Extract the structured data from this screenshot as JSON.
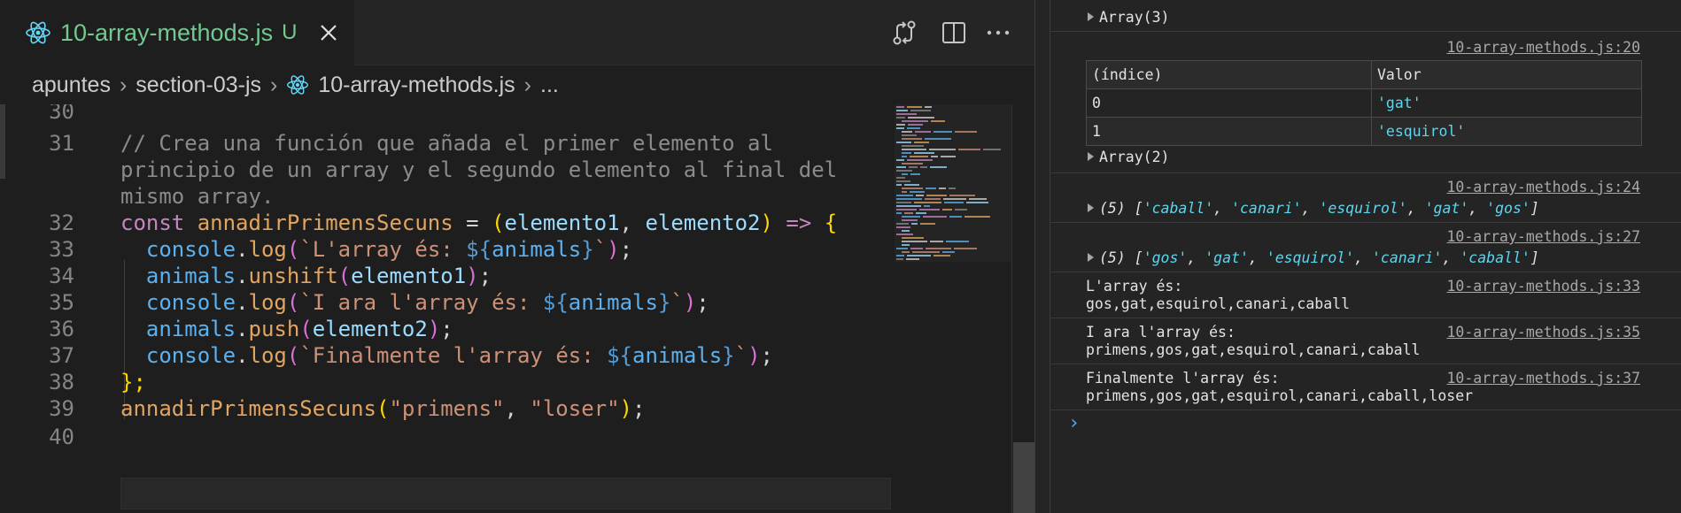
{
  "editor": {
    "tab": {
      "filename": "10-array-methods.js",
      "status": "U"
    },
    "breadcrumb": [
      "apuntes",
      "section-03-js",
      "10-array-methods.js",
      "..."
    ],
    "gutter": [
      "30",
      "31",
      "",
      "",
      "32",
      "33",
      "34",
      "35",
      "36",
      "37",
      "38",
      "39",
      "40"
    ],
    "code": {
      "comment_1": "// Crea una función que añada el primer elemento al",
      "comment_2": "principio de un array y el segundo elemento al final del",
      "comment_3": "mismo array.",
      "l32": {
        "kw": "const",
        "name": "annadirPrimensSecuns",
        "eq": " = ",
        "p1": "elemento1",
        "comma": ", ",
        "p2": "elemento2",
        "arrow": " => ",
        "brace": "{"
      },
      "l33": {
        "obj": "console",
        "method": "log",
        "tpl": "`L'array és: ",
        "var": "animals",
        "tpl_end": "`"
      },
      "l34": {
        "obj": "animals",
        "method": "unshift",
        "arg": "elemento1"
      },
      "l35": {
        "obj": "console",
        "method": "log",
        "tpl": "`I ara l'array és: ",
        "var": "animals",
        "tpl_end": "`"
      },
      "l36": {
        "obj": "animals",
        "method": "push",
        "arg": "elemento2"
      },
      "l37": {
        "obj": "console",
        "method": "log",
        "tpl": "`Finalmente l'array és: ",
        "var": "animals",
        "tpl_end": "`"
      },
      "l38": "};",
      "l39": {
        "name": "annadirPrimensSecuns",
        "a1": "\"primens\"",
        "a2": "\"loser\""
      }
    }
  },
  "console": {
    "collapsed_array_top": "Array(3)",
    "entry_20": {
      "source": "10-array-methods.js:20",
      "table_headers": [
        "(índice)",
        "Valor"
      ],
      "rows": [
        {
          "index": "0",
          "value": "'gat'"
        },
        {
          "index": "1",
          "value": "'esquirol'"
        }
      ],
      "collapsed": "Array(2)"
    },
    "entry_24": {
      "source": "10-array-methods.js:24",
      "count": "(5)",
      "items": [
        "'caball'",
        "'canari'",
        "'esquirol'",
        "'gat'",
        "'gos'"
      ]
    },
    "entry_27": {
      "source": "10-array-methods.js:27",
      "count": "(5)",
      "items": [
        "'gos'",
        "'gat'",
        "'esquirol'",
        "'canari'",
        "'caball'"
      ]
    },
    "entry_33": {
      "source": "10-array-methods.js:33",
      "line1": "L'array és:",
      "line2": "gos,gat,esquirol,canari,caball"
    },
    "entry_35": {
      "source": "10-array-methods.js:35",
      "line1": "I ara l'array és:",
      "line2": "primens,gos,gat,esquirol,canari,caball"
    },
    "entry_37": {
      "source": "10-array-methods.js:37",
      "line1": "Finalmente l'array és:",
      "line2": "primens,gos,gat,esquirol,canari,caball,loser"
    },
    "prompt": "›"
  },
  "colors": {
    "modified_green": "#73c991",
    "console_string": "#5cd5ee",
    "react_blue": "#61dafb"
  }
}
